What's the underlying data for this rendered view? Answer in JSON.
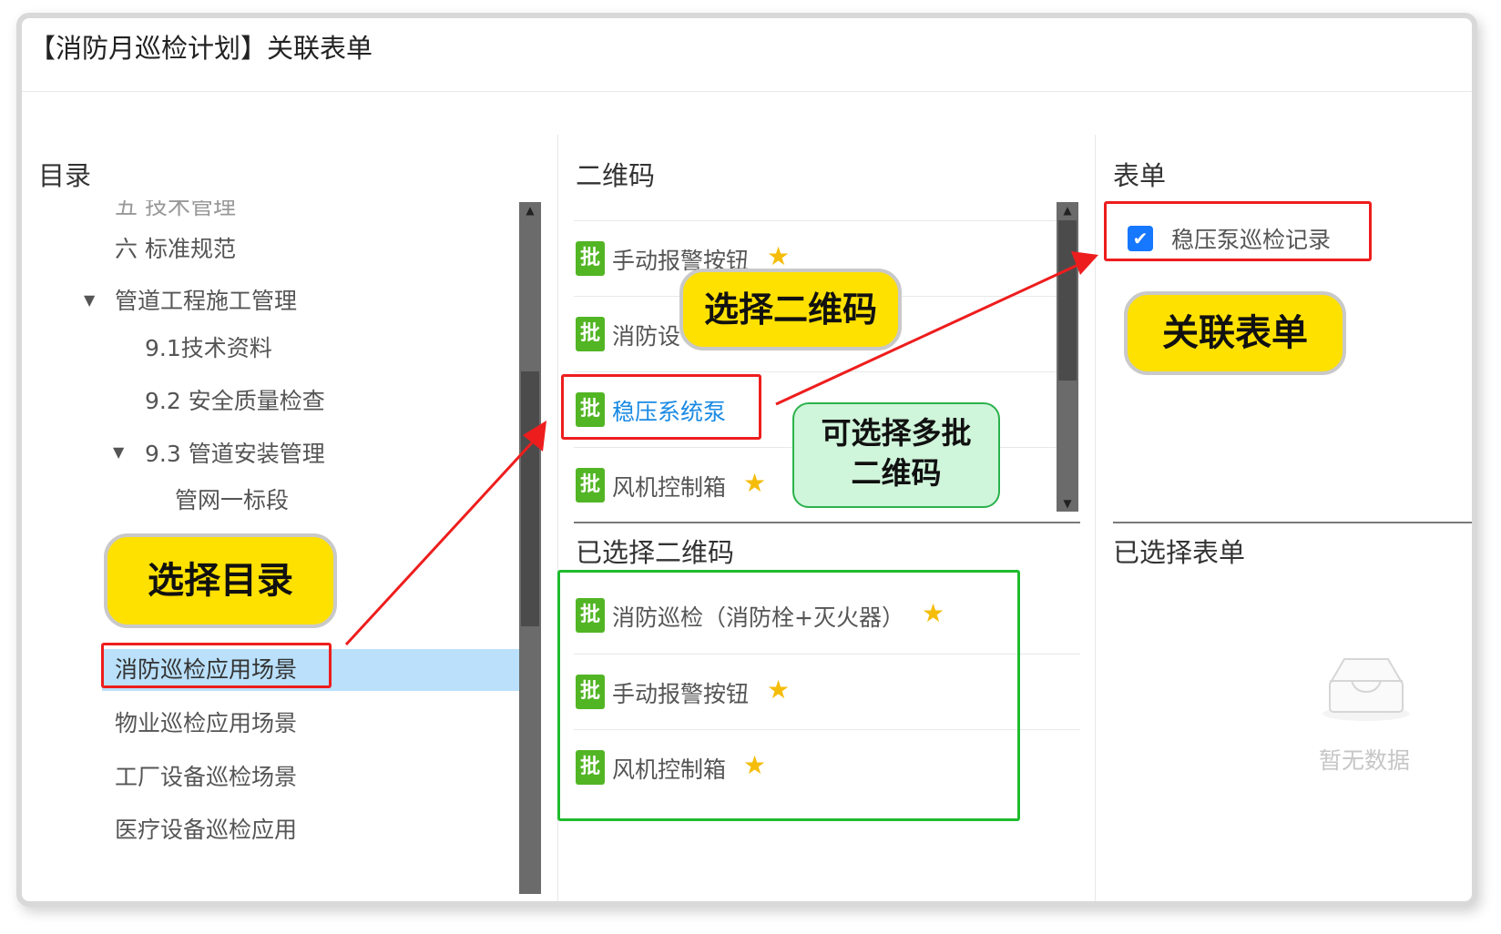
{
  "dialog": {
    "title": "【消防月巡检计划】关联表单"
  },
  "catalog": {
    "title": "目录",
    "items": [
      {
        "label": "五 技术管理"
      },
      {
        "label": "六 标准规范"
      },
      {
        "label": "管道工程施工管理"
      },
      {
        "label": "9.1技术资料"
      },
      {
        "label": "9.2 安全质量检查"
      },
      {
        "label": "9.3 管道安装管理"
      },
      {
        "label": "管网一标段"
      },
      {
        "label": "消防巡检应用场景"
      },
      {
        "label": "物业巡检应用场景"
      },
      {
        "label": "工厂设备巡检场景"
      },
      {
        "label": "医疗设备巡检应用"
      }
    ]
  },
  "qrcodes": {
    "title": "二维码",
    "badge": "批",
    "items": [
      {
        "label": "手动报警按钮",
        "starred": true
      },
      {
        "label": "消防设",
        "starred": false
      },
      {
        "label": "稳压系统泵",
        "starred": false
      },
      {
        "label": "风机控制箱",
        "starred": true
      }
    ]
  },
  "selected_qrcodes": {
    "title": "已选择二维码",
    "badge": "批",
    "items": [
      {
        "label": "消防巡检（消防栓+灭火器）",
        "starred": true
      },
      {
        "label": "手动报警按钮",
        "starred": true
      },
      {
        "label": "风机控制箱",
        "starred": true
      }
    ]
  },
  "forms": {
    "title": "表单",
    "items": [
      {
        "label": "稳压泵巡检记录",
        "checked": true
      }
    ]
  },
  "selected_forms": {
    "title": "已选择表单",
    "empty_text": "暂无数据"
  },
  "annotations": {
    "select_catalog": "选择目录",
    "select_qrcode": "选择二维码",
    "link_form": "关联表单",
    "multi_line1": "可选择多批",
    "multi_line2": "二维码"
  },
  "icons": {
    "star": "star-icon",
    "checkbox": "check-icon",
    "caret": "caret-down-icon",
    "empty": "empty-inbox-icon"
  },
  "colors": {
    "badge": "#52b524",
    "star": "#f5bd0a",
    "link": "#1a8ae4",
    "selected_row": "#bae0fb",
    "highlight_red": "#ee1d1d",
    "highlight_green": "#1fbb2e",
    "callout_yellow": "#ffe100",
    "callout_green": "#cff5da"
  }
}
